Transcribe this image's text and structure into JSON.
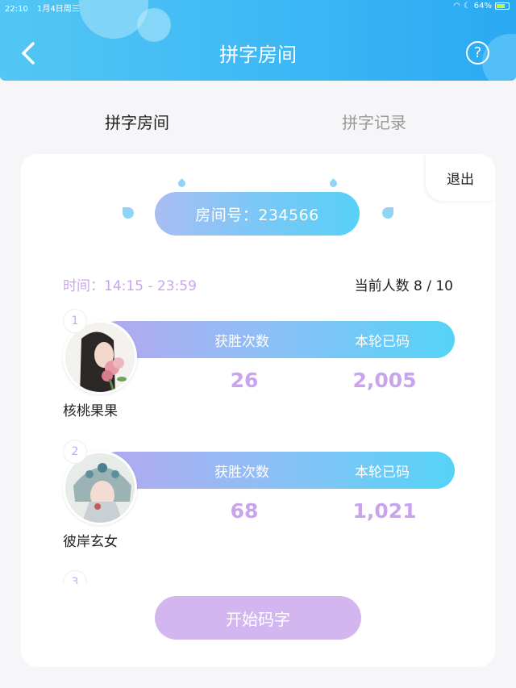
{
  "status_bar": {
    "time": "22:10",
    "date": "1月4日周三",
    "battery": "64%"
  },
  "header": {
    "title": "拼字房间"
  },
  "tabs": [
    {
      "label": "拼字房间",
      "active": true
    },
    {
      "label": "拼字记录",
      "active": false
    }
  ],
  "room": {
    "exit_label": "退出",
    "room_label": "房间号：234566",
    "time_label": "时间：14:15 - 23:59",
    "count_label": "当前人数 8 / 10"
  },
  "stat_labels": {
    "wins": "获胜次数",
    "typed": "本轮已码"
  },
  "players": [
    {
      "rank": "1",
      "name": "核桃果果",
      "wins": "26",
      "typed": "2,005"
    },
    {
      "rank": "2",
      "name": "彼岸玄女",
      "wins": "68",
      "typed": "1,021"
    },
    {
      "rank": "3"
    }
  ],
  "start_button": "开始码字",
  "colors": {
    "header": "#3bb6f5",
    "accent_purple": "#c7a4ec",
    "button": "#d3b6f0"
  }
}
